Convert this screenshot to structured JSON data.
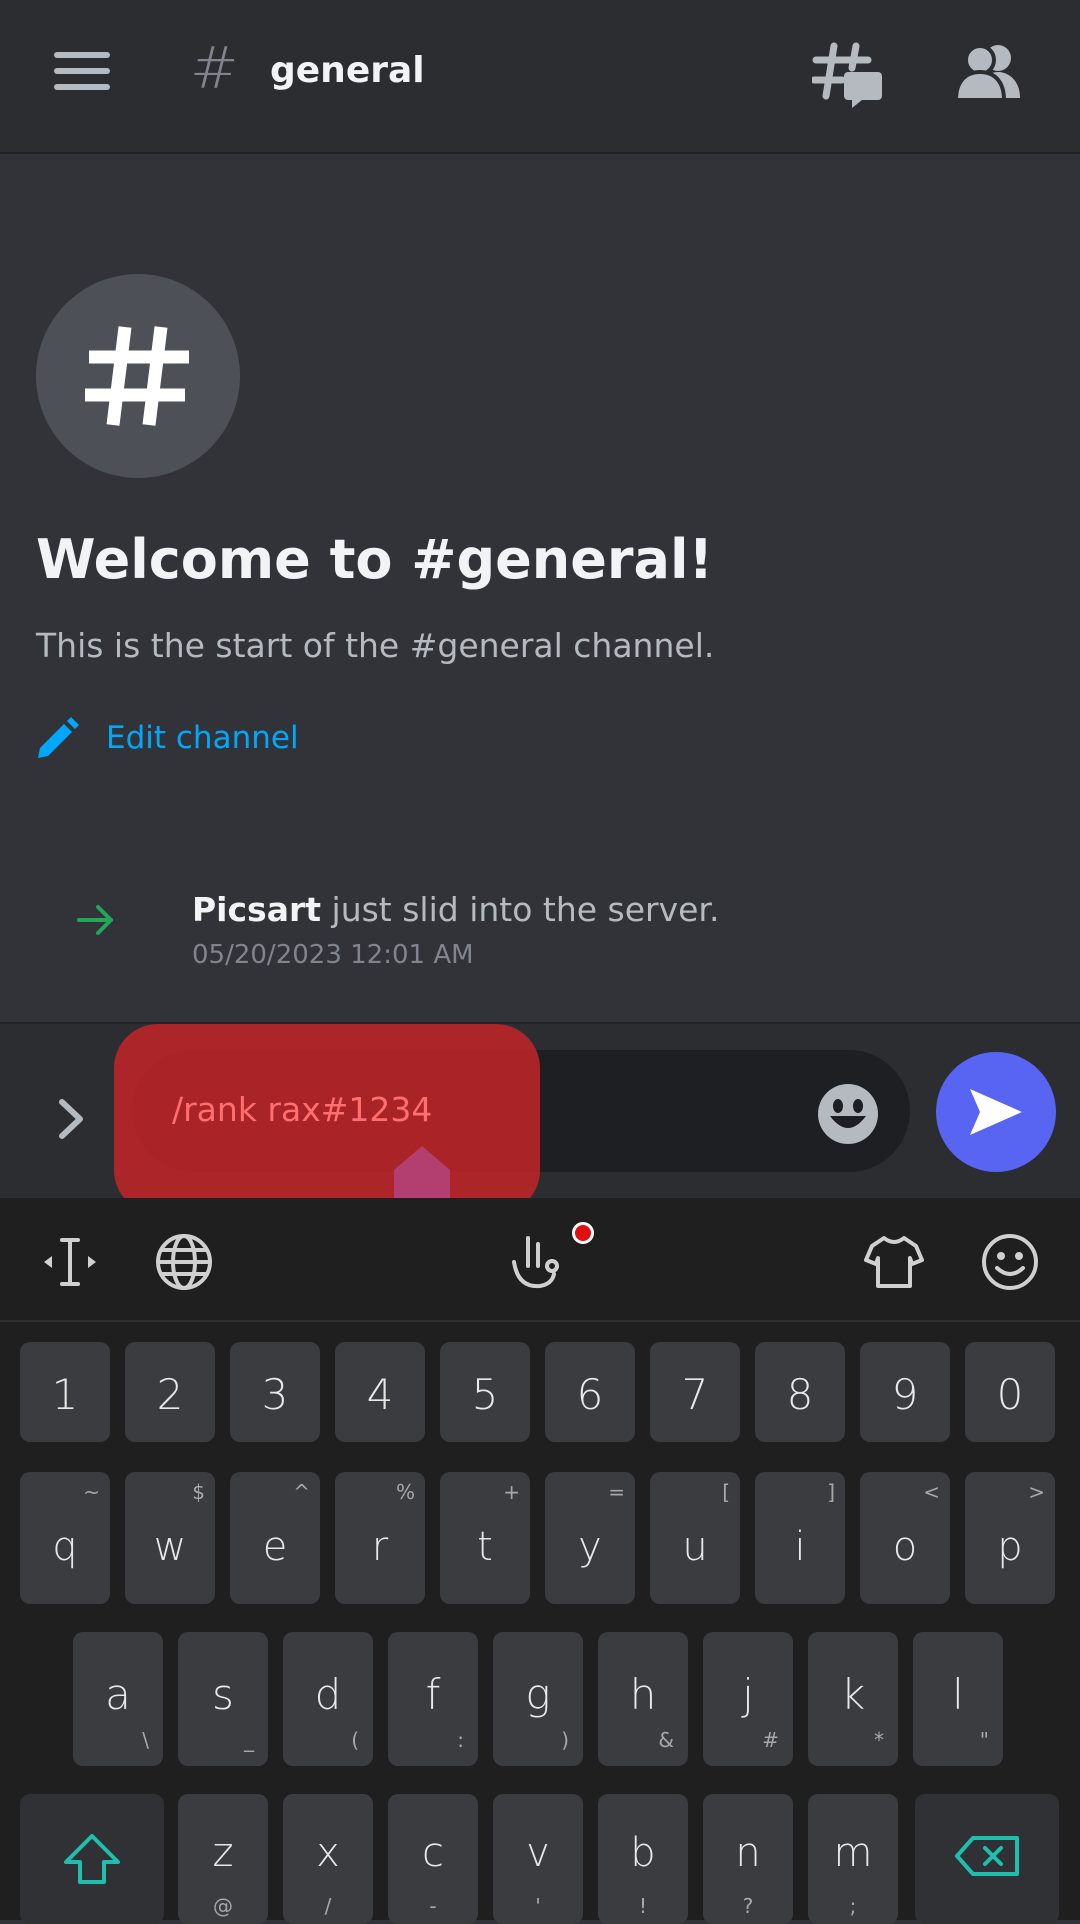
{
  "header": {
    "channel_hash": "#",
    "channel_name": "general"
  },
  "welcome": {
    "title": "Welcome to #general!",
    "subtitle": "This is the start of the #general channel.",
    "edit_label": "Edit channel"
  },
  "messages": [
    {
      "username": "Picsart",
      "text": " just slid into the server.",
      "timestamp": "05/20/2023 12:01 AM"
    }
  ],
  "composer": {
    "input_value": "/rank rax#1234"
  },
  "keyboard": {
    "numbers": [
      "1",
      "2",
      "3",
      "4",
      "5",
      "6",
      "7",
      "8",
      "9",
      "0"
    ],
    "row1": [
      {
        "key": "q",
        "alt": "~"
      },
      {
        "key": "w",
        "alt": "$"
      },
      {
        "key": "e",
        "alt": "^"
      },
      {
        "key": "r",
        "alt": "%"
      },
      {
        "key": "t",
        "alt": "+"
      },
      {
        "key": "y",
        "alt": "="
      },
      {
        "key": "u",
        "alt": "["
      },
      {
        "key": "i",
        "alt": "]"
      },
      {
        "key": "o",
        "alt": "<"
      },
      {
        "key": "p",
        "alt": ">"
      }
    ],
    "row2": [
      {
        "key": "a",
        "alt": "\\"
      },
      {
        "key": "s",
        "alt": "_"
      },
      {
        "key": "d",
        "alt": "("
      },
      {
        "key": "f",
        "alt": ":"
      },
      {
        "key": "g",
        "alt": ")"
      },
      {
        "key": "h",
        "alt": "&"
      },
      {
        "key": "j",
        "alt": "#"
      },
      {
        "key": "k",
        "alt": "*"
      },
      {
        "key": "l",
        "alt": "\""
      }
    ],
    "row3": [
      {
        "key": "z",
        "alt": "@"
      },
      {
        "key": "x",
        "alt": "/"
      },
      {
        "key": "c",
        "alt": "-"
      },
      {
        "key": "v",
        "alt": "'"
      },
      {
        "key": "b",
        "alt": "!"
      },
      {
        "key": "n",
        "alt": "?"
      },
      {
        "key": "m",
        "alt": ";"
      }
    ]
  },
  "colors": {
    "background": "#313338",
    "header": "#2b2d31",
    "accent_blue": "#00a8fc",
    "send_button": "#5865f2",
    "join_arrow": "#23a55a",
    "overlay_red": "#be2428",
    "keyboard_teal": "#1fbfb0"
  },
  "icons": {
    "menu": "hamburger-icon",
    "threads": "threads-icon",
    "members": "members-icon",
    "edit": "pencil-icon",
    "join": "arrow-right-icon",
    "expand": "chevron-right-icon",
    "emoji": "smiley-icon",
    "send": "send-icon",
    "shift": "shift-arrow-icon",
    "backspace": "backspace-icon"
  }
}
